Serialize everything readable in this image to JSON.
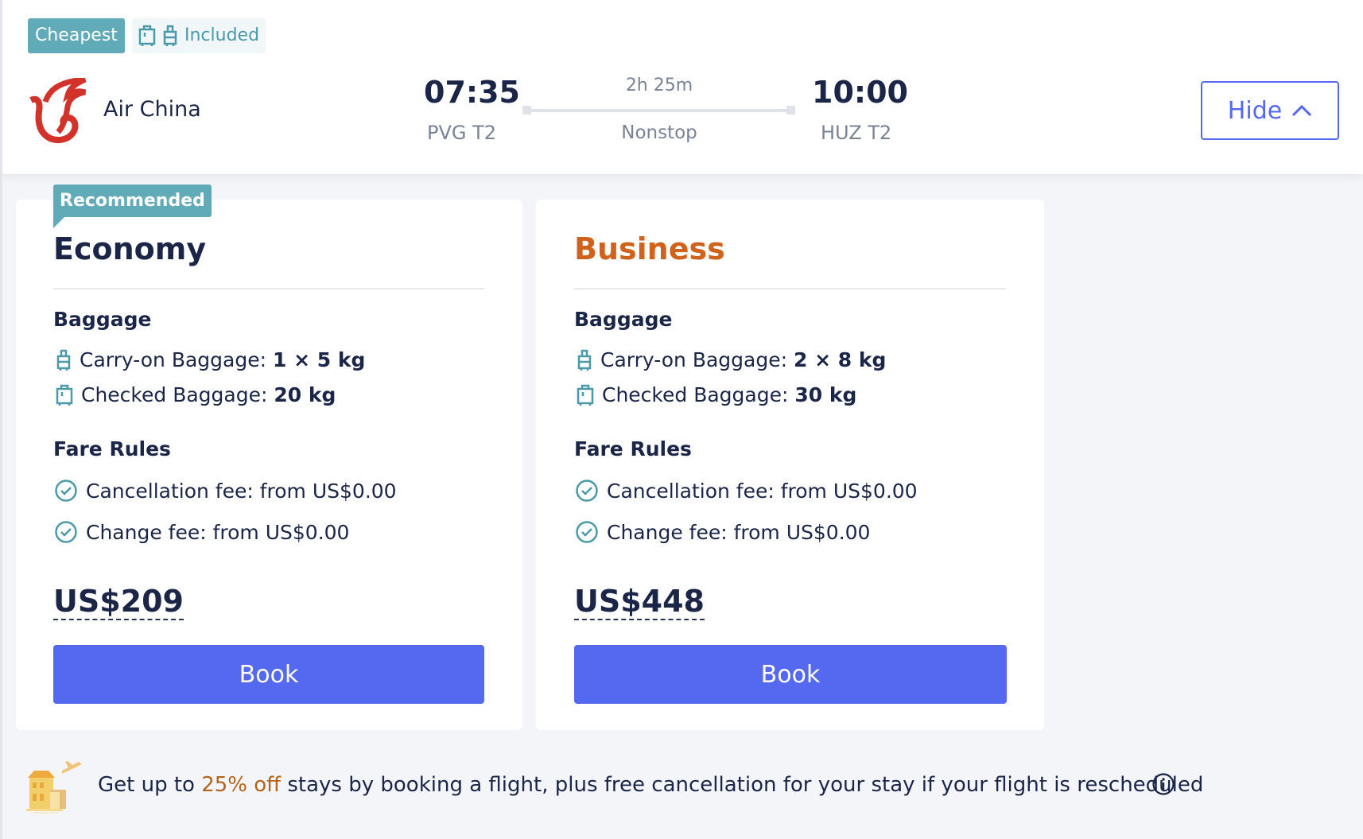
{
  "badges": {
    "cheapest": "Cheapest",
    "included": "Included"
  },
  "flight": {
    "airline": "Air China",
    "depart_time": "07:35",
    "depart_airport": "PVG T2",
    "duration": "2h 25m",
    "stops": "Nonstop",
    "arrive_time": "10:00",
    "arrive_airport": "HUZ T2",
    "hide_label": "Hide"
  },
  "colors": {
    "accent": "#5468f0",
    "teal": "#61abb8",
    "business": "#d0621c"
  },
  "fares": [
    {
      "tag": "Recommended",
      "name": "Economy",
      "baggage_title": "Baggage",
      "carry_label": "Carry-on Baggage: ",
      "carry_value": "1 × 5 kg",
      "checked_label": "Checked Baggage: ",
      "checked_value": "20 kg",
      "rules_title": "Fare Rules",
      "cancel": "Cancellation fee: from US$0.00",
      "change": "Change fee: from US$0.00",
      "price": "US$209",
      "book": "Book"
    },
    {
      "name": "Business",
      "baggage_title": "Baggage",
      "carry_label": "Carry-on Baggage: ",
      "carry_value": "2 × 8 kg",
      "checked_label": "Checked Baggage: ",
      "checked_value": "30 kg",
      "rules_title": "Fare Rules",
      "cancel": "Cancellation fee: from US$0.00",
      "change": "Change fee: from US$0.00",
      "price": "US$448",
      "book": "Book"
    }
  ],
  "promo": {
    "pre": "Get up to ",
    "highlight": "25% off",
    "post": " stays by booking a flight, plus free cancellation for your stay if your flight is rescheduled"
  }
}
